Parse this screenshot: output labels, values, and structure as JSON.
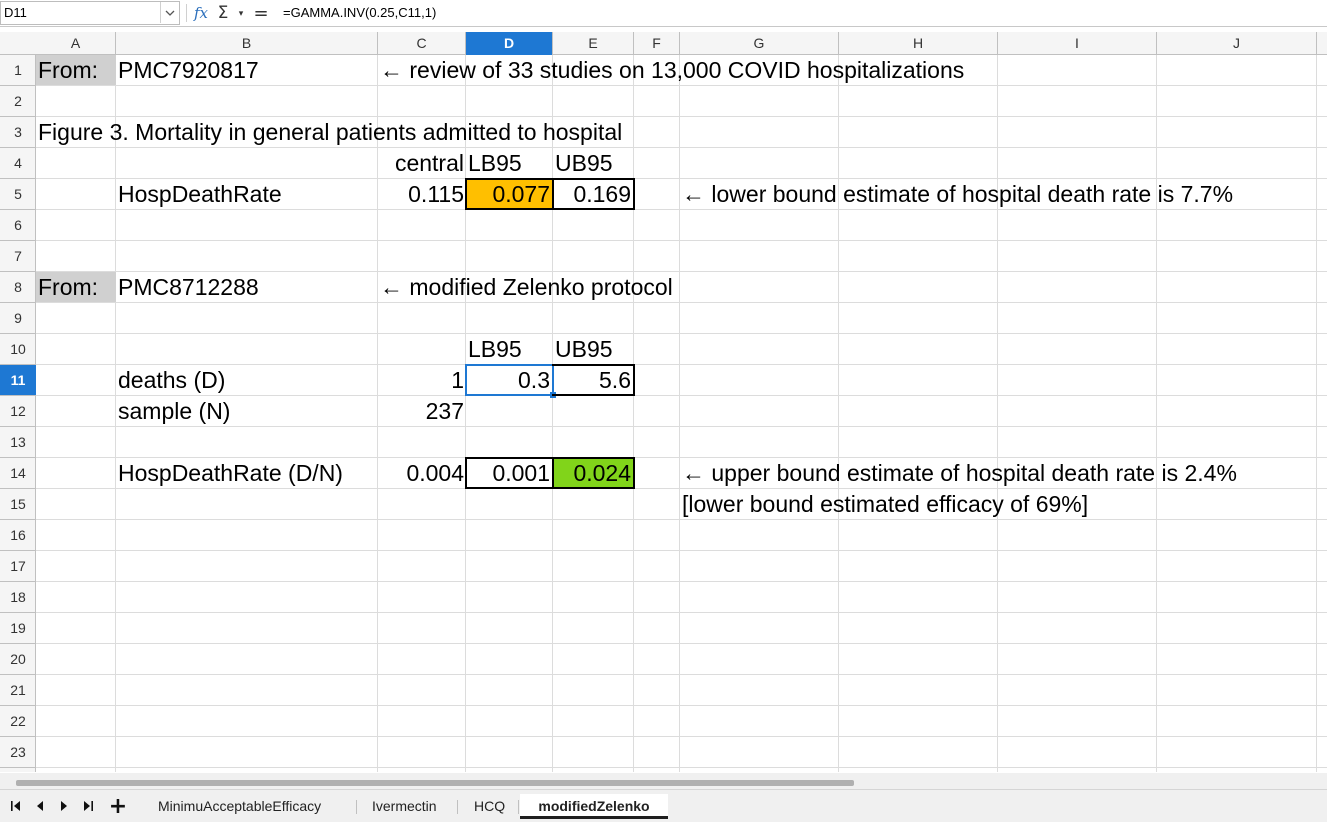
{
  "formula_bar": {
    "name_box": "D11",
    "formula": "=GAMMA.INV(0.25,C11,1)",
    "icons": [
      "chevron-down-icon",
      "function-wizard-icon",
      "sum-icon",
      "equals-icon"
    ]
  },
  "columns": [
    "A",
    "B",
    "C",
    "D",
    "E",
    "F",
    "G",
    "H",
    "I",
    "J"
  ],
  "rows": [
    "1",
    "2",
    "3",
    "4",
    "5",
    "6",
    "7",
    "8",
    "9",
    "10",
    "11",
    "12",
    "13",
    "14",
    "15",
    "16",
    "17",
    "18",
    "19",
    "20",
    "21",
    "22",
    "23"
  ],
  "cells": {
    "A1": "From:",
    "B1": "PMC7920817",
    "C1": "← review of 33 studies on 13,000 COVID hospitalizations",
    "A3": "Figure 3. Mortality in general patients admitted to hospital",
    "C4": "central",
    "D4": "LB95",
    "E4": "UB95",
    "B5": "HospDeathRate",
    "C5": "0.115",
    "D5": "0.077",
    "E5": "0.169",
    "G5": "← lower bound estimate of hospital death rate is 7.7%",
    "A8": "From:",
    "B8": "PMC8712288",
    "C8": "← modified Zelenko protocol",
    "D10": "LB95",
    "E10": "UB95",
    "B11": "deaths (D)",
    "C11": "1",
    "D11": "0.3",
    "E11": "5.6",
    "B12": "sample (N)",
    "C12": "237",
    "B14": "HospDeathRate (D/N)",
    "C14": "0.004",
    "D14": "0.001",
    "E14": "0.024",
    "G14": "← upper bound estimate of hospital death rate is 2.4%",
    "G15": "[lower bound estimated efficacy of 69%]"
  },
  "colors": {
    "selection": "#1e78d3",
    "orange_fill": "#ffbf00",
    "green_fill": "#81d41a",
    "grey_fill": "#d0d0d0"
  },
  "sheet_tabs": {
    "tabs": [
      "MinimuAcceptableEfficacy",
      "Ivermectin",
      "HCQ",
      "modifiedZelenko"
    ],
    "active": "modifiedZelenko",
    "nav_icons": [
      "first-sheet-icon",
      "prev-sheet-icon",
      "next-sheet-icon",
      "last-sheet-icon",
      "add-sheet-icon"
    ]
  }
}
